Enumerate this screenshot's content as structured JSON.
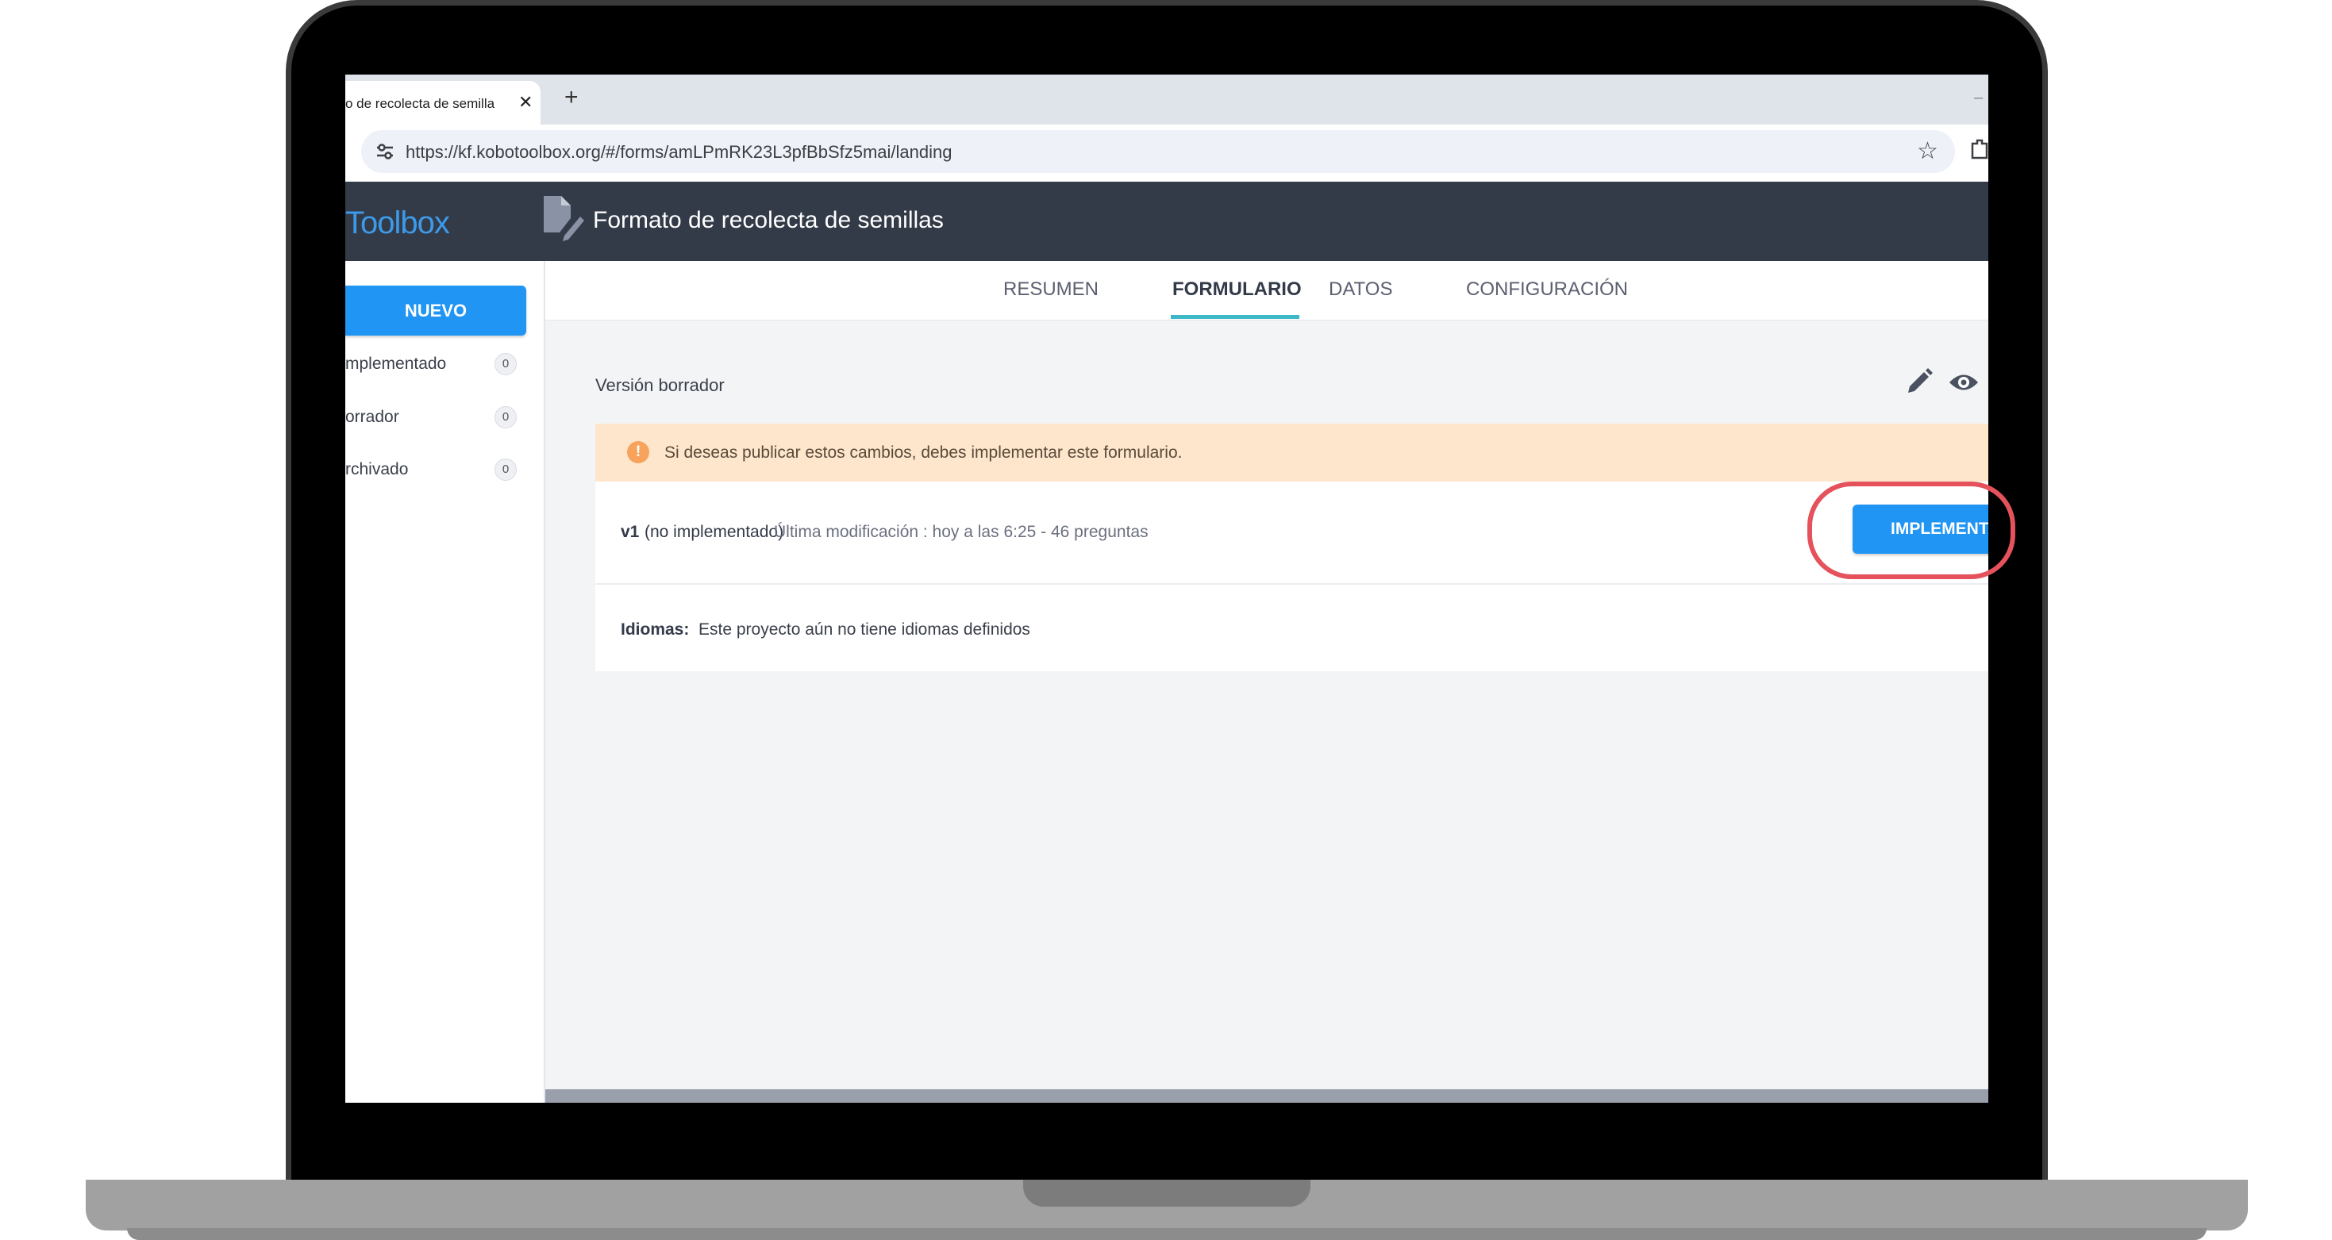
{
  "browser": {
    "tab_title": "o de recolecta de semilla",
    "tab_close": "✕",
    "new_tab": "+",
    "url": "https://kf.kobotoolbox.org/#/forms/amLPmRK23L3pfBbSfz5mai/landing",
    "icons": [
      "site-settings-icon",
      "star-icon",
      "extensions-icon"
    ]
  },
  "app": {
    "logo": "Toolbox",
    "form_title": "Formato de recolecta de semillas"
  },
  "sidebar": {
    "new_button": "NUEVO",
    "items": [
      {
        "label": "mplementado",
        "count": "0"
      },
      {
        "label": "orrador",
        "count": "0"
      },
      {
        "label": "rchivado",
        "count": "0"
      }
    ]
  },
  "tabs": [
    {
      "label": "RESUMEN",
      "active": false
    },
    {
      "label": "FORMULARIO",
      "active": true
    },
    {
      "label": "DATOS",
      "active": false
    },
    {
      "label": "CONFIGURACIÓN",
      "active": false
    }
  ],
  "form": {
    "version_label": "Versión borrador",
    "warning_icon": "!",
    "warning": "Si deseas publicar estos cambios, debes implementar este formulario.",
    "version_number": "v1",
    "version_status": "(no implementado)",
    "version_meta_prefix": "Última modificación : hoy a las 6:25 - ",
    "version_questions": "46",
    "version_meta_suffix": " preguntas",
    "deploy_button": "IMPLEMENTAR",
    "languages_label": "Idiomas:",
    "languages_text": "Este proyecto aún no tiene idiomas definidos"
  },
  "colors": {
    "header": "#333a48",
    "primary": "#2095f3",
    "tab_underline": "#3cb8c6",
    "warning_bg": "#fde6cc",
    "highlight": "#e5525c"
  }
}
